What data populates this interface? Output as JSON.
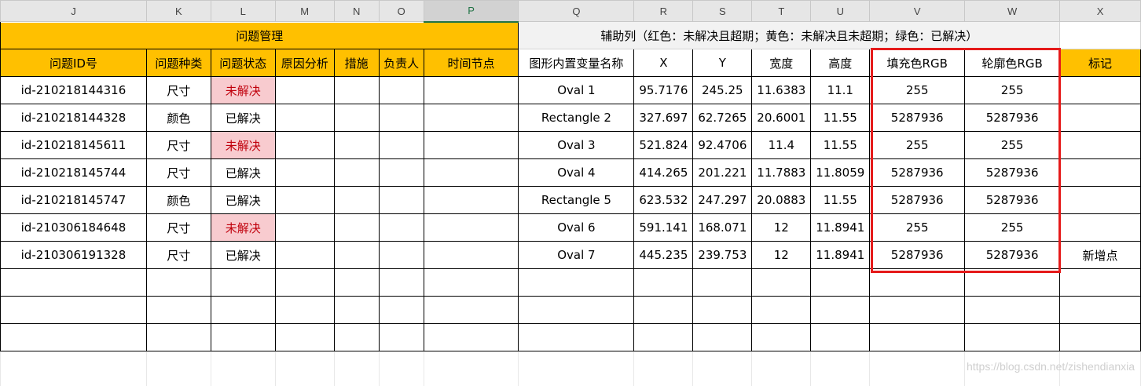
{
  "column_headers": [
    "J",
    "K",
    "L",
    "M",
    "N",
    "O",
    "P",
    "Q",
    "R",
    "S",
    "T",
    "U",
    "V",
    "W",
    "X"
  ],
  "selected_column": "P",
  "left_section": {
    "title": "问题管理",
    "headers": [
      "问题ID号",
      "问题种类",
      "问题状态",
      "原因分析",
      "措施",
      "负责人",
      "时间节点"
    ]
  },
  "right_section": {
    "title": "辅助列（红色：未解决且超期；黄色：未解决且未超期；绿色：已解决）",
    "headers": [
      "图形内置变量名称",
      "X",
      "Y",
      "宽度",
      "高度",
      "填充色RGB",
      "轮廓色RGB",
      "标记"
    ]
  },
  "rows": [
    {
      "id": "id-210218144316",
      "type": "尺寸",
      "status": "未解决",
      "unresolved": true,
      "shape": "Oval 1",
      "x": "95.7176",
      "y": "245.25",
      "w": "11.6383",
      "h": "11.1",
      "fill": "255",
      "outline": "255",
      "mark": ""
    },
    {
      "id": "id-210218144328",
      "type": "颜色",
      "status": "已解决",
      "unresolved": false,
      "shape": "Rectangle 2",
      "x": "327.697",
      "y": "62.7265",
      "w": "20.6001",
      "h": "11.55",
      "fill": "5287936",
      "outline": "5287936",
      "mark": ""
    },
    {
      "id": "id-210218145611",
      "type": "尺寸",
      "status": "未解决",
      "unresolved": true,
      "shape": "Oval 3",
      "x": "521.824",
      "y": "92.4706",
      "w": "11.4",
      "h": "11.55",
      "fill": "255",
      "outline": "255",
      "mark": ""
    },
    {
      "id": "id-210218145744",
      "type": "尺寸",
      "status": "已解决",
      "unresolved": false,
      "shape": "Oval 4",
      "x": "414.265",
      "y": "201.221",
      "w": "11.7883",
      "h": "11.8059",
      "fill": "5287936",
      "outline": "5287936",
      "mark": ""
    },
    {
      "id": "id-210218145747",
      "type": "颜色",
      "status": "已解决",
      "unresolved": false,
      "shape": "Rectangle 5",
      "x": "623.532",
      "y": "247.297",
      "w": "20.0883",
      "h": "11.55",
      "fill": "5287936",
      "outline": "5287936",
      "mark": ""
    },
    {
      "id": "id-210306184648",
      "type": "尺寸",
      "status": "未解决",
      "unresolved": true,
      "shape": "Oval 6",
      "x": "591.141",
      "y": "168.071",
      "w": "12",
      "h": "11.8941",
      "fill": "255",
      "outline": "255",
      "mark": ""
    },
    {
      "id": "id-210306191328",
      "type": "尺寸",
      "status": "已解决",
      "unresolved": false,
      "shape": "Oval 7",
      "x": "445.235",
      "y": "239.753",
      "w": "12",
      "h": "11.8941",
      "fill": "5287936",
      "outline": "5287936",
      "mark": "新增点"
    }
  ],
  "watermark": "https://blog.csdn.net/zishendianxia",
  "colors": {
    "header_orange": "#ffc000",
    "unresolved_bg": "#f8cbcf",
    "unresolved_text": "#c0000c",
    "highlight_box": "#e51a1a"
  }
}
